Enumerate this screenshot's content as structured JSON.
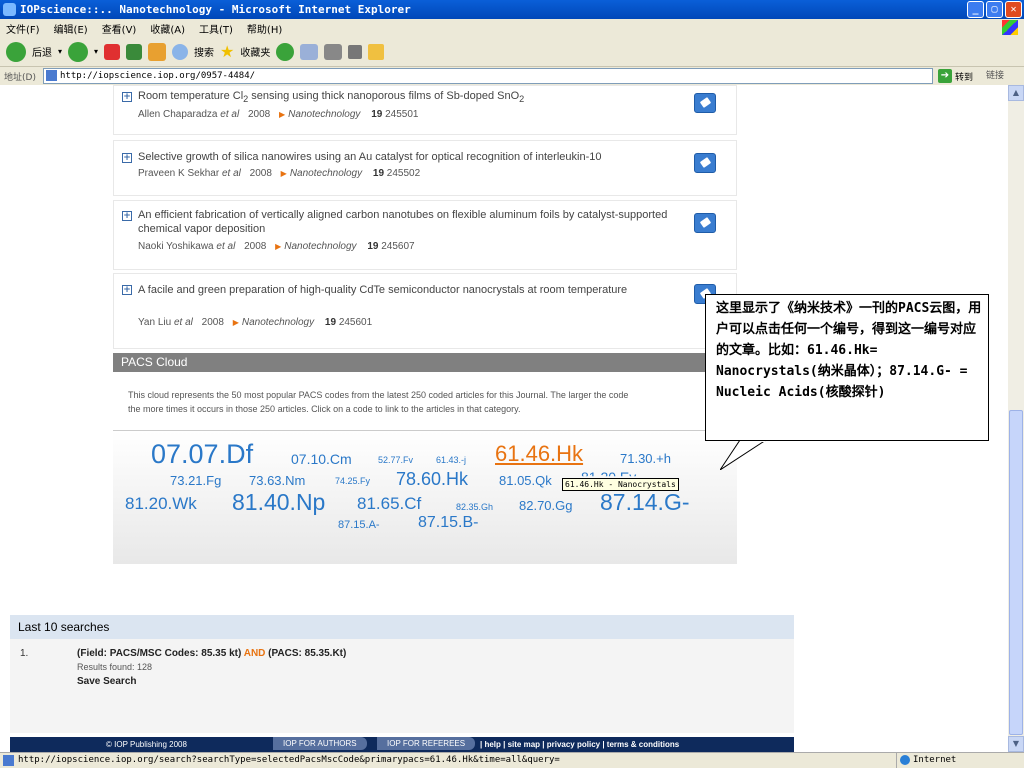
{
  "window": {
    "title": "IOPscience::.. Nanotechnology - Microsoft Internet Explorer",
    "minimize": "_",
    "maximize": "▢",
    "close": "✕"
  },
  "menu": [
    "文件(F)",
    "编辑(E)",
    "查看(V)",
    "收藏(A)",
    "工具(T)",
    "帮助(H)"
  ],
  "toolbar": {
    "back": "后退",
    "search": "搜索",
    "favorites": "收藏夹"
  },
  "address": {
    "label": "地址(D)",
    "url": "http://iopscience.iop.org/0957-4484/",
    "go": "转到",
    "links": "链接"
  },
  "articles": [
    {
      "title_html": "Room temperature Cl<sub>2</sub> sensing using thick nanoporous films of Sb-doped SnO<sub>2</sub>",
      "authors": "Allen Chaparadza",
      "etal": "et al",
      "year": "2008",
      "journal": "Nanotechnology",
      "vol": "19",
      "num": "245501"
    },
    {
      "title_html": "Selective growth of silica nanowires using an Au catalyst for optical recognition of interleukin-10",
      "authors": "Praveen K Sekhar",
      "etal": "et al",
      "year": "2008",
      "journal": "Nanotechnology",
      "vol": "19",
      "num": "245502"
    },
    {
      "title_html": "An efficient fabrication of vertically aligned carbon nanotubes on flexible aluminum foils by catalyst-supported chemical vapor deposition",
      "authors": "Naoki Yoshikawa",
      "etal": "et al",
      "year": "2008",
      "journal": "Nanotechnology",
      "vol": "19",
      "num": "245607"
    },
    {
      "title_html": "A facile and green preparation of high-quality CdTe semiconductor nanocrystals at room temperature",
      "authors": "Yan Liu",
      "etal": "et al",
      "year": "2008",
      "journal": "Nanotechnology",
      "vol": "19",
      "num": "245601"
    }
  ],
  "pacs": {
    "heading": "PACS Cloud",
    "desc1": "This cloud represents the 50 most popular PACS codes from the latest 250 coded articles for this Journal. The larger the code",
    "desc2": "the more times it occurs in those 250 articles. Click on a code to link to the articles in that category.",
    "codes": [
      "07.07.Df",
      "07.10.Cm",
      "52.77.Fv",
      "61.43.-j",
      "61.46.Hk",
      "71.30.+h",
      "73.21.Fg",
      "73.63.Nm",
      "74.25.Fy",
      "78.60.Hk",
      "81.05.Qk",
      "81.20.Ev",
      "81.20.Wk",
      "81.40.Np",
      "81.65.Cf",
      "82.35.Gh",
      "82.70.Gg",
      "87.14.G-",
      "87.15.A-",
      "87.15.B-"
    ],
    "tooltip": "61.46.Hk - Nanocrystals"
  },
  "callout": {
    "text": "这里显示了《纳米技术》一刊的PACS云图，用户可以点击任何一个编号，得到这一编号对应的文章。比如：61.46.Hk= Nanocrystals(纳米晶体）；87.14.G- = Nucleic Acids(核酸探针)"
  },
  "searches": {
    "heading": "Last 10 searches",
    "num": "1.",
    "q1": "(Field: PACS/MSC Codes: 85.35 kt)",
    "op": "AND",
    "q2": "(PACS: 85.35.Kt)",
    "found": "Results found: 128",
    "save": "Save Search"
  },
  "footer": {
    "copyright": "© IOP Publishing 2008",
    "authors_btn": "IOP FOR AUTHORS",
    "referees_btn": "IOP FOR REFEREES",
    "links": "|  help  |  site map  |  privacy policy  |  terms & conditions"
  },
  "status": {
    "url": "http://iopscience.iop.org/search?searchType=selectedPacsMscCode&primarypacs=61.46.Hk&time=all&query=",
    "zone": "Internet"
  }
}
